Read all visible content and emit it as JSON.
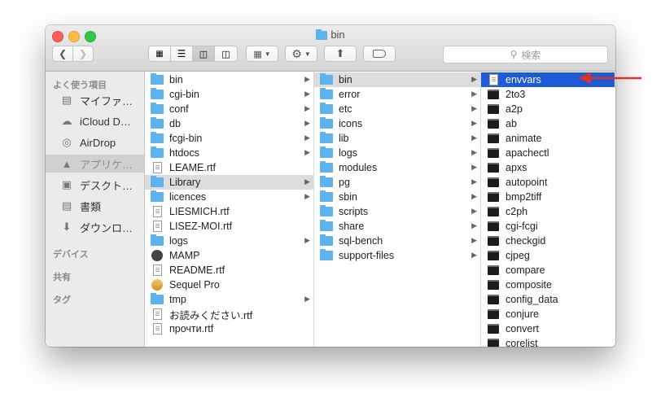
{
  "window": {
    "title": "bin"
  },
  "toolbar": {
    "search_placeholder": "検索",
    "colors": {
      "close": "#fc605b",
      "minimize": "#fdbc40",
      "maximize": "#34c84a"
    }
  },
  "sidebar": {
    "favorites_header": "よく使う項目",
    "items": [
      {
        "label": "マイファ…",
        "icon": "files-icon"
      },
      {
        "label": "iCloud D…",
        "icon": "cloud-icon"
      },
      {
        "label": "AirDrop",
        "icon": "airdrop-icon"
      },
      {
        "label": "アプリケ…",
        "icon": "applications-icon"
      },
      {
        "label": "デスクト…",
        "icon": "desktop-icon"
      },
      {
        "label": "書類",
        "icon": "documents-icon"
      },
      {
        "label": "ダウンロ…",
        "icon": "downloads-icon"
      }
    ],
    "devices_header": "デバイス",
    "shared_header": "共有",
    "tags_header": "タグ"
  },
  "column1": [
    {
      "name": "bin",
      "type": "folder",
      "arrow": true
    },
    {
      "name": "cgi-bin",
      "type": "folder",
      "arrow": true
    },
    {
      "name": "conf",
      "type": "folder",
      "arrow": true
    },
    {
      "name": "db",
      "type": "folder",
      "arrow": true
    },
    {
      "name": "fcgi-bin",
      "type": "folder",
      "arrow": true
    },
    {
      "name": "htdocs",
      "type": "folder",
      "arrow": true
    },
    {
      "name": "LEAME.rtf",
      "type": "doc",
      "arrow": false
    },
    {
      "name": "Library",
      "type": "folder",
      "arrow": true,
      "highlight": true
    },
    {
      "name": "licences",
      "type": "folder",
      "arrow": true
    },
    {
      "name": "LIESMICH.rtf",
      "type": "doc",
      "arrow": false
    },
    {
      "name": "LISEZ-MOI.rtf",
      "type": "doc",
      "arrow": false
    },
    {
      "name": "logs",
      "type": "folder",
      "arrow": true
    },
    {
      "name": "MAMP",
      "type": "app",
      "arrow": false
    },
    {
      "name": "README.rtf",
      "type": "doc",
      "arrow": false
    },
    {
      "name": "Sequel Pro",
      "type": "sql",
      "arrow": false
    },
    {
      "name": "tmp",
      "type": "folder",
      "arrow": true
    },
    {
      "name": "お読みください.rtf",
      "type": "doc",
      "arrow": false
    },
    {
      "name": "прочти.rtf",
      "type": "doc",
      "arrow": false
    }
  ],
  "column2": [
    {
      "name": "bin",
      "type": "folder",
      "arrow": true,
      "highlight": true
    },
    {
      "name": "error",
      "type": "folder",
      "arrow": true
    },
    {
      "name": "etc",
      "type": "folder",
      "arrow": true
    },
    {
      "name": "icons",
      "type": "folder",
      "arrow": true
    },
    {
      "name": "lib",
      "type": "folder",
      "arrow": true
    },
    {
      "name": "logs",
      "type": "folder",
      "arrow": true
    },
    {
      "name": "modules",
      "type": "folder",
      "arrow": true
    },
    {
      "name": "pg",
      "type": "folder",
      "arrow": true
    },
    {
      "name": "sbin",
      "type": "folder",
      "arrow": true
    },
    {
      "name": "scripts",
      "type": "folder",
      "arrow": true
    },
    {
      "name": "share",
      "type": "folder",
      "arrow": true
    },
    {
      "name": "sql-bench",
      "type": "folder",
      "arrow": true
    },
    {
      "name": "support-files",
      "type": "folder",
      "arrow": true
    }
  ],
  "column3": [
    {
      "name": "envvars",
      "type": "doc",
      "selected": true
    },
    {
      "name": "2to3",
      "type": "exe"
    },
    {
      "name": "a2p",
      "type": "exe"
    },
    {
      "name": "ab",
      "type": "exe"
    },
    {
      "name": "animate",
      "type": "exe"
    },
    {
      "name": "apachectl",
      "type": "exe"
    },
    {
      "name": "apxs",
      "type": "exe"
    },
    {
      "name": "autopoint",
      "type": "exe"
    },
    {
      "name": "bmp2tiff",
      "type": "exe"
    },
    {
      "name": "c2ph",
      "type": "exe"
    },
    {
      "name": "cgi-fcgi",
      "type": "exe"
    },
    {
      "name": "checkgid",
      "type": "exe"
    },
    {
      "name": "cjpeg",
      "type": "exe"
    },
    {
      "name": "compare",
      "type": "exe"
    },
    {
      "name": "composite",
      "type": "exe"
    },
    {
      "name": "config_data",
      "type": "exe"
    },
    {
      "name": "conjure",
      "type": "exe"
    },
    {
      "name": "convert",
      "type": "exe"
    },
    {
      "name": "corelist",
      "type": "exe"
    }
  ],
  "annotation": {
    "arrow_color": "#d9332b"
  }
}
